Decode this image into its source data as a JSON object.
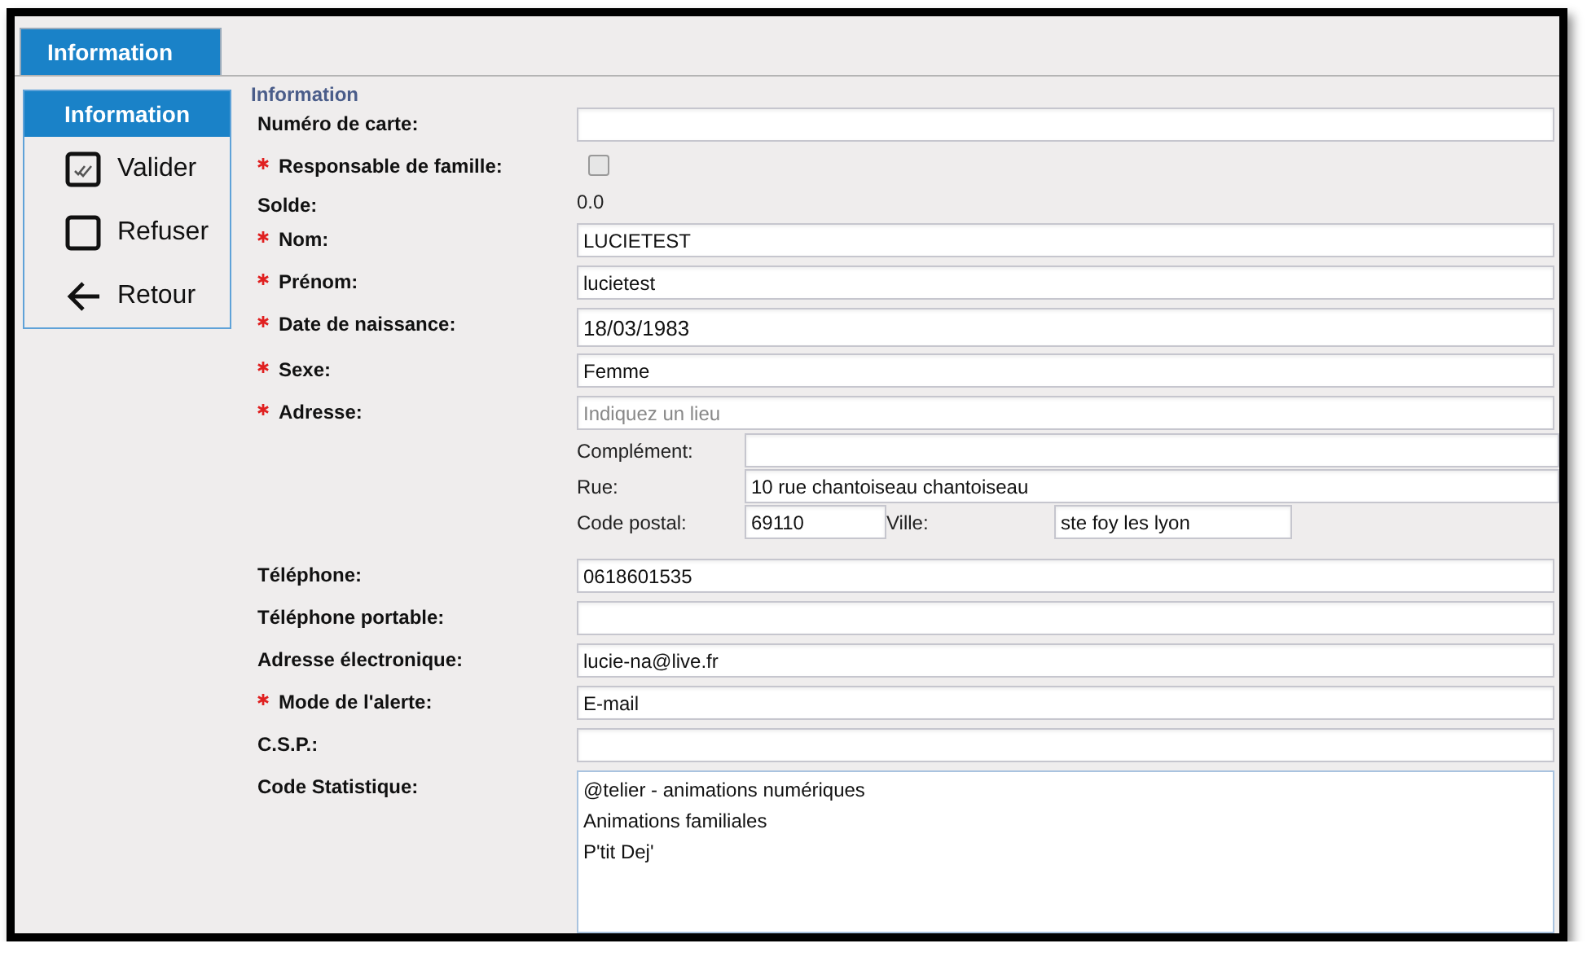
{
  "tabs": [
    {
      "label": "Information",
      "selected": true
    }
  ],
  "sidebar": {
    "title": "Information",
    "items": [
      {
        "label": "Valider",
        "kind": "validate"
      },
      {
        "label": "Refuser",
        "kind": "refuse"
      },
      {
        "label": "Retour",
        "kind": "back"
      }
    ]
  },
  "form": {
    "section_title": "Information",
    "rows": [
      {
        "kind": "text",
        "label": "Numéro de carte:",
        "required": false
      },
      {
        "kind": "checkbox",
        "label": "Responsable de famille:",
        "required": true,
        "checked": false
      },
      {
        "kind": "static",
        "label": "Solde:",
        "required": false,
        "value": "0.0"
      },
      {
        "kind": "text",
        "label": "Nom:",
        "required": true,
        "value": "LUCIETEST"
      },
      {
        "kind": "text",
        "label": "Prénom:",
        "required": true,
        "value": "lucietest"
      },
      {
        "kind": "date",
        "label": "Date de naissance:",
        "required": true,
        "value": "18/03/1983"
      },
      {
        "kind": "text",
        "label": "Sexe:",
        "required": true,
        "value": "Femme"
      },
      {
        "kind": "address",
        "label": "Adresse:",
        "required": true,
        "placeholder": "Indiquez un lieu",
        "complement_label": "Complément:",
        "street_label": "Rue:",
        "street": "10 rue chantoiseau chantoiseau",
        "postcode_label": "Code postal:",
        "postcode": "69110",
        "city_label": "Ville:",
        "city": "ste foy les lyon"
      },
      {
        "kind": "text",
        "label": "Téléphone:",
        "required": false,
        "value": "0618601535"
      },
      {
        "kind": "text",
        "label": "Téléphone portable:",
        "required": false
      },
      {
        "kind": "text",
        "label": "Adresse électronique:",
        "required": false,
        "value": "lucie-na@live.fr"
      },
      {
        "kind": "text",
        "label": "Mode de l'alerte:",
        "required": true,
        "value": "E-mail"
      },
      {
        "kind": "text",
        "label": "C.S.P.:",
        "required": false
      },
      {
        "kind": "list",
        "label": "Code Statistique:",
        "required": false,
        "values": [
          "@telier - animations numériques",
          "Animations familiales",
          "P'tit Dej'"
        ]
      }
    ]
  }
}
